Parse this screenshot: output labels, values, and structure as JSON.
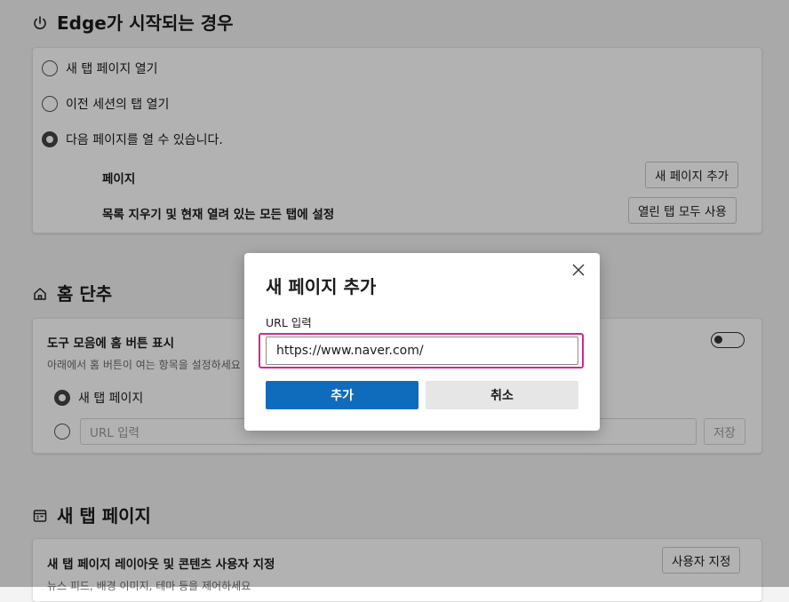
{
  "startup": {
    "title": "Edge가 시작되는 경우",
    "options": [
      {
        "label": "새 탭 페이지 열기",
        "checked": false
      },
      {
        "label": "이전 세션의 탭 열기",
        "checked": false
      },
      {
        "label": "다음 페이지를 열 수 있습니다.",
        "checked": true
      }
    ],
    "pages_label": "페이지",
    "add_page_button": "새 페이지 추가",
    "clear_label": "목록 지우기 및 현재 열려 있는 모든 탭에 설정",
    "use_open_tabs_button": "열린 탭 모두 사용"
  },
  "home": {
    "title": "홈 단추",
    "toolbar_label": "도구 모음에 홈 버튼 표시",
    "toolbar_sub": "아래에서 홈 버튼이 여는 항목을 설정하세요",
    "toggle_on": false,
    "option_newtab": "새 탭 페이지",
    "url_placeholder": "URL 입력",
    "save_button": "저장"
  },
  "newtab": {
    "title": "새 탭 페이지",
    "customize_label": "새 탭 페이지 레이아웃 및 콘텐츠 사용자 지정",
    "customize_sub": "뉴스 피드, 배경 이미지, 테마 등을 제어하세요",
    "customize_button": "사용자 지정"
  },
  "dialog": {
    "title": "새 페이지 추가",
    "field_label": "URL 입력",
    "url_value": "https://www.naver.com/",
    "add_button": "추가",
    "cancel_button": "취소",
    "accent_color": "#0f6cbd",
    "focus_color": "#d1288c"
  }
}
